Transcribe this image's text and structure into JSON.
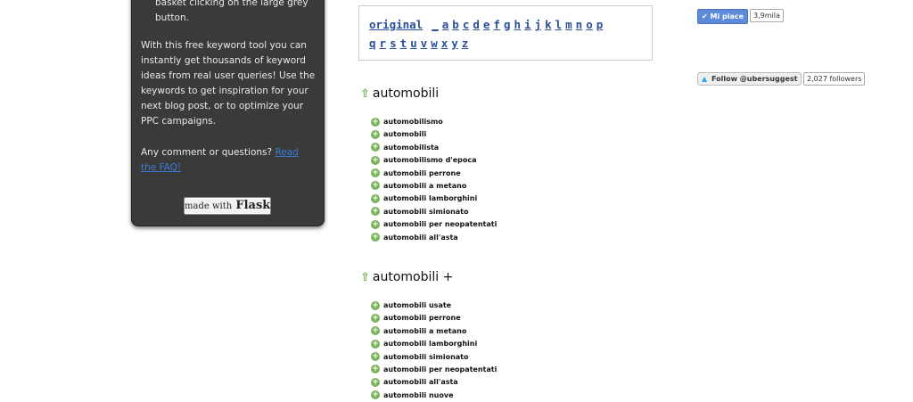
{
  "panel": {
    "text1": "basket clicking on the large grey button.",
    "text2": "With this free keyword tool you can instantly get thousands of keyword ideas from real user queries! Use the keywords to get inspiration for your next blog post, or to optimize your PPC campaigns.",
    "text3_prefix": "Any comment or questions? ",
    "faq_link": "Read the FAQ!",
    "flask_made_with": "made with",
    "flask_word": "Flask"
  },
  "alphabet": {
    "row1": [
      "original",
      "_",
      "a",
      "b",
      "c",
      "d",
      "e",
      "f",
      "g",
      "h",
      "i",
      "j",
      "k",
      "l",
      "m",
      "n",
      "o",
      "p"
    ],
    "row2": [
      "q",
      "r",
      "s",
      "t",
      "u",
      "v",
      "w",
      "x",
      "y",
      "z"
    ]
  },
  "social": {
    "like_label": "Mi piace",
    "like_count": "3,9mila",
    "twitter_label": "Follow @ubersuggest",
    "twitter_count": "2,027 followers"
  },
  "sections": [
    {
      "title": "automobili",
      "items": [
        "automobilismo",
        "automobili",
        "automobilista",
        "automobilismo d'epoca",
        "automobili perrone",
        "automobili a metano",
        "automobili lamborghini",
        "automobili simionato",
        "automobili per neopatentati",
        "automobili all'asta"
      ]
    },
    {
      "title": "automobili +",
      "items": [
        "automobili usate",
        "automobili perrone",
        "automobili a metano",
        "automobili lamborghini",
        "automobili simionato",
        "automobili per neopatentati",
        "automobili all'asta",
        "automobili nuove"
      ]
    }
  ],
  "colors": {
    "panel_bg": "#3a3a3a",
    "link": "#2a4f9a",
    "plus_green": "#7ab35a",
    "facebook_blue": "#5d8ad9",
    "twitter_blue": "#2ea3ec"
  }
}
